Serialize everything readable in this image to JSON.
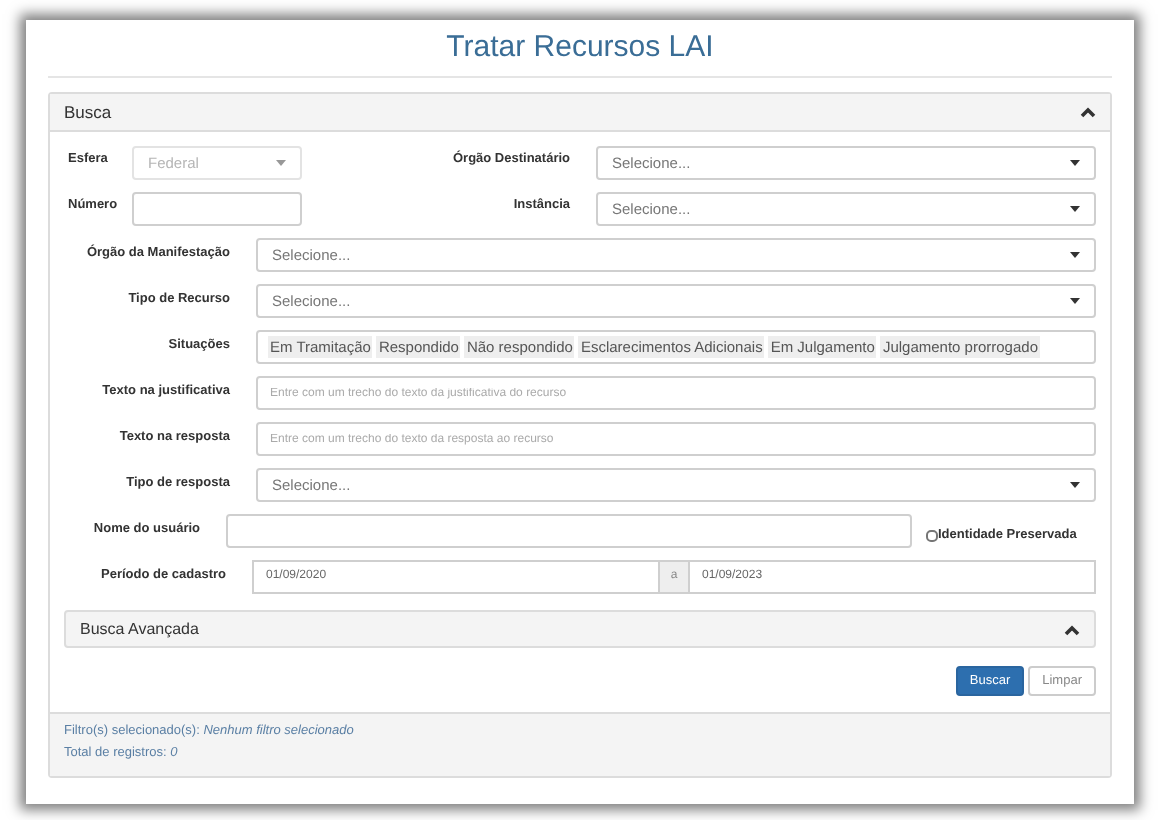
{
  "page_title": "Tratar Recursos LAI",
  "search_panel": {
    "title": "Busca"
  },
  "pair_fields": [
    {
      "label": "Esfera",
      "kind": "select",
      "value": "Federal",
      "disabled": true
    },
    {
      "label": "Órgão Destinatário",
      "kind": "select",
      "placeholder": "Selecione...",
      "disabled": false
    },
    {
      "label": "Número",
      "kind": "text",
      "disabled": false
    },
    {
      "label": "Instância",
      "kind": "select",
      "placeholder": "Selecione...",
      "disabled": false
    }
  ],
  "fields": [
    {
      "label": "Órgão da Manifestação",
      "kind": "select",
      "placeholder": "Selecione..."
    },
    {
      "label": "Tipo de Recurso",
      "kind": "select",
      "placeholder": "Selecione..."
    },
    {
      "label": "Situações",
      "kind": "tags",
      "tags": [
        "Em Tramitação",
        "Respondido",
        "Não respondido",
        "Esclarecimentos Adicionais",
        "Em Julgamento",
        "Julgamento prorrogado"
      ]
    },
    {
      "label": "Texto na justificativa",
      "kind": "text",
      "placeholder": "Entre com um trecho do texto da justificativa do recurso"
    },
    {
      "label": "Texto na resposta",
      "kind": "text",
      "placeholder": "Entre com um trecho do texto da resposta ao recurso"
    },
    {
      "label": "Tipo de resposta",
      "kind": "select",
      "placeholder": "Selecione..."
    },
    {
      "label": "Nome do usuário",
      "kind": "text",
      "checkbox": {
        "label": "Identidade Preservada",
        "checked": false
      }
    },
    {
      "label": "Período de cadastro",
      "kind": "range",
      "from": "01/09/2020",
      "separator": "a",
      "to": "01/09/2023"
    }
  ],
  "advanced_panel": {
    "title": "Busca Avançada"
  },
  "buttons": [
    {
      "label": "Buscar",
      "kind": "primary"
    },
    {
      "label": "Limpar",
      "kind": "default"
    }
  ],
  "footer": {
    "filters": "Filtro(s) selecionado(s): *Nenhum filtro selecionado*",
    "total": "Total de registros: *0*"
  }
}
